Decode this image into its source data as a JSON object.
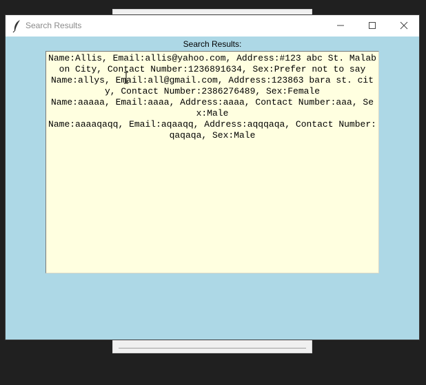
{
  "background_window": {},
  "window": {
    "title": "Search Results",
    "icon": "tk-feather-icon",
    "controls": {
      "minimize_icon": "minimize-icon",
      "maximize_icon": "maximize-icon",
      "close_icon": "close-icon"
    },
    "background_color": "#add8e6"
  },
  "main": {
    "label": "Search Results:",
    "results_background": "#ffffe0",
    "results": [
      "Name:Allis, Email:allis@yahoo.com, Address:#123 abc St. Malabon City, Contact Number:1236891634, Sex:Prefer not to say",
      "Name:allys, Email:all@gmail.com, Address:123863 bara st. city, Contact Number:2386276489, Sex:Female",
      "Name:aaaaa, Email:aaaa, Address:aaaa, Contact Number:aaa, Sex:Male",
      "Name:aaaaqaqq, Email:aqaaqq, Address:aqqqaqa, Contact Number:qaqaqa, Sex:Male"
    ]
  }
}
